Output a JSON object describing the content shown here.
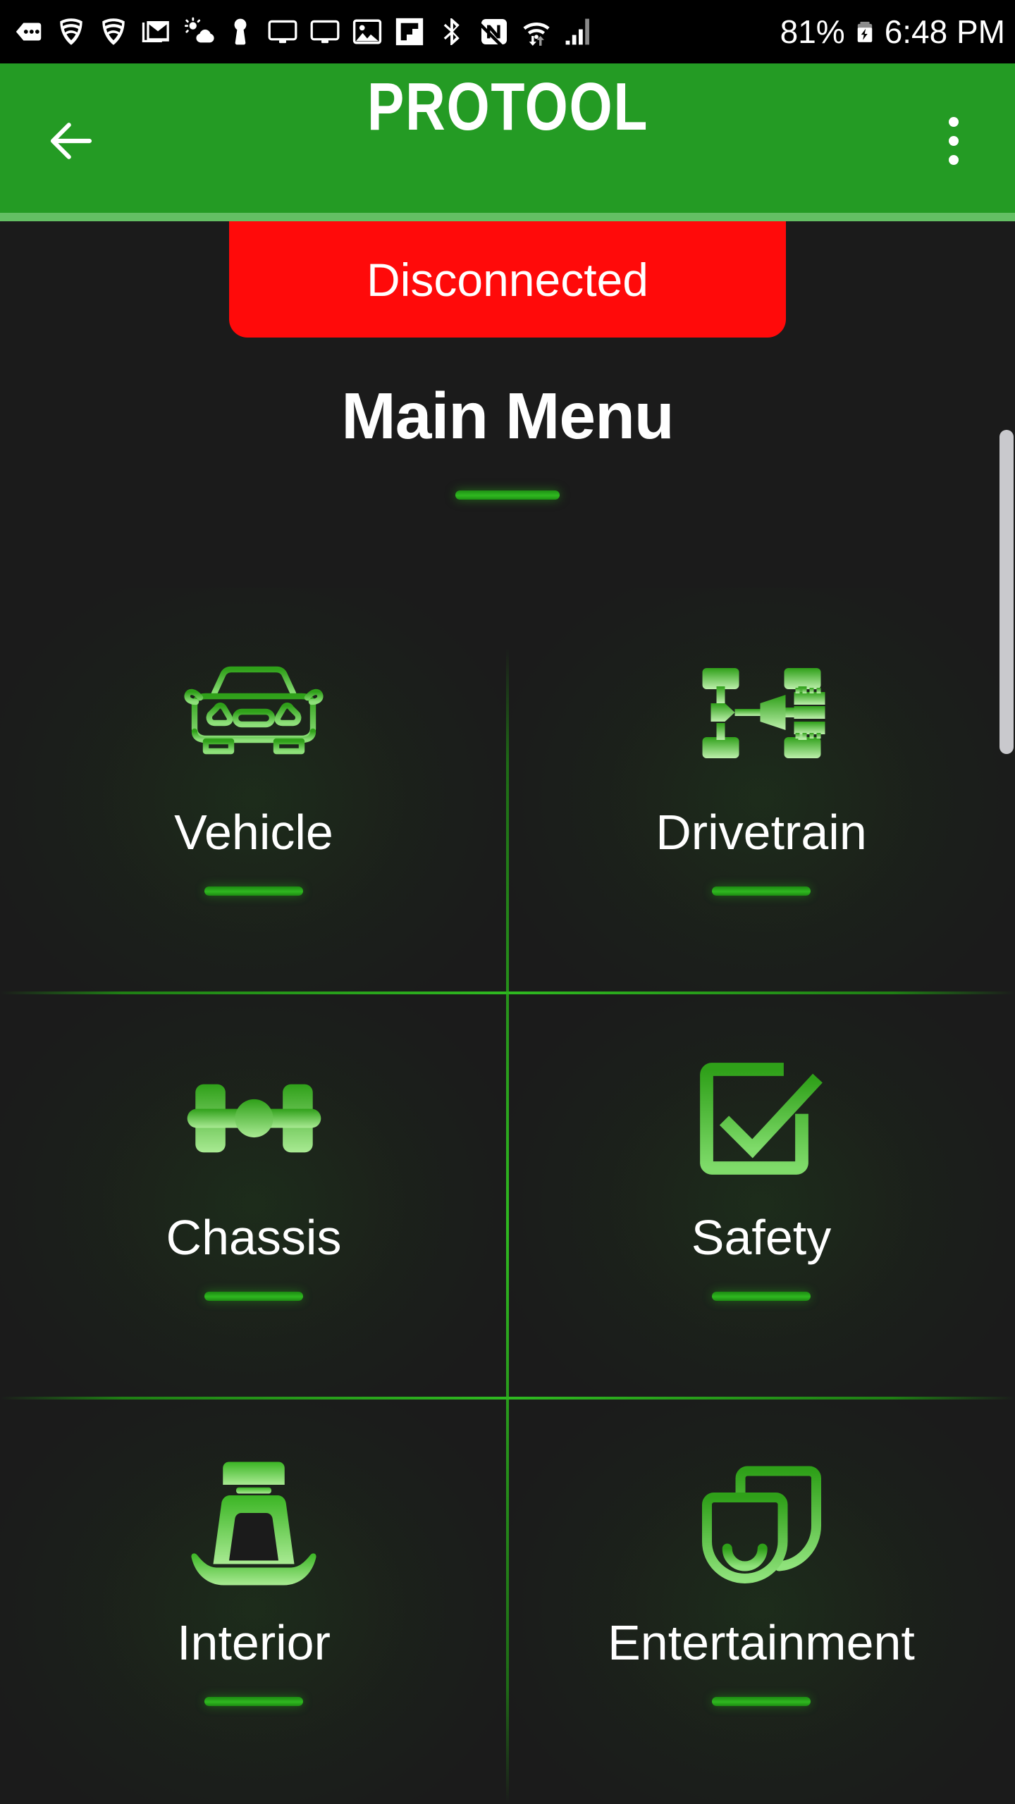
{
  "statusbar": {
    "icons_left": [
      "messages-dots-icon",
      "wifi-shield-icon",
      "wifi-shield-icon",
      "gmail-icon",
      "weather-partly-cloudy-icon",
      "keyhole-icon",
      "cast-screen-icon",
      "cast-screen-icon",
      "photo-icon",
      "flipboard-icon",
      "bluetooth-icon",
      "nfc-icon",
      "wifi-data-transfer-icon",
      "cellular-signal-icon"
    ],
    "battery_percent": "81%",
    "battery_icon": "battery-charging-icon",
    "time": "6:48 PM"
  },
  "appbar": {
    "back_icon": "back-arrow-icon",
    "title": "PROTOOL",
    "overflow_icon": "more-vertical-icon",
    "background_color": "#249B24",
    "underline_color": "#64BF64"
  },
  "connection": {
    "status_label": "Disconnected",
    "status_color": "#FF0A0A"
  },
  "screen": {
    "title": "Main Menu",
    "accent_color": "#2FB820",
    "background_color": "#1b1b1b"
  },
  "menu": {
    "items": [
      {
        "label": "Vehicle",
        "icon": "car-front-icon"
      },
      {
        "label": "Drivetrain",
        "icon": "drivetrain-icon"
      },
      {
        "label": "Chassis",
        "icon": "axle-icon"
      },
      {
        "label": "Safety",
        "icon": "checkbox-check-icon"
      },
      {
        "label": "Interior",
        "icon": "car-seat-icon"
      },
      {
        "label": "Entertainment",
        "icon": "media-screens-icon"
      }
    ]
  },
  "scrollbar": {
    "name": "vertical-scrollbar"
  }
}
